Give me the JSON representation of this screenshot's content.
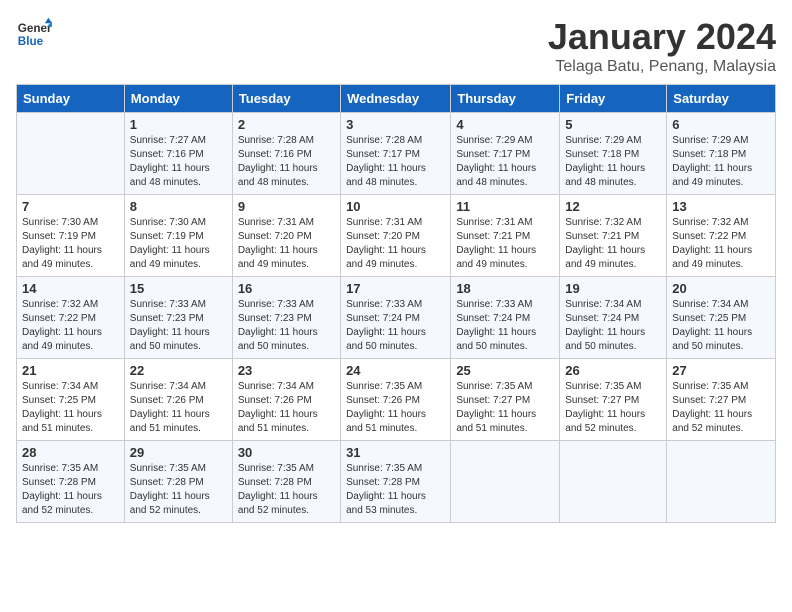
{
  "logo": {
    "line1": "General",
    "line2": "Blue"
  },
  "calendar": {
    "title": "January 2024",
    "subtitle": "Telaga Batu, Penang, Malaysia"
  },
  "days_of_week": [
    "Sunday",
    "Monday",
    "Tuesday",
    "Wednesday",
    "Thursday",
    "Friday",
    "Saturday"
  ],
  "weeks": [
    [
      {
        "day": "",
        "sunrise": "",
        "sunset": "",
        "daylight": ""
      },
      {
        "day": "1",
        "sunrise": "Sunrise: 7:27 AM",
        "sunset": "Sunset: 7:16 PM",
        "daylight": "Daylight: 11 hours and 48 minutes."
      },
      {
        "day": "2",
        "sunrise": "Sunrise: 7:28 AM",
        "sunset": "Sunset: 7:16 PM",
        "daylight": "Daylight: 11 hours and 48 minutes."
      },
      {
        "day": "3",
        "sunrise": "Sunrise: 7:28 AM",
        "sunset": "Sunset: 7:17 PM",
        "daylight": "Daylight: 11 hours and 48 minutes."
      },
      {
        "day": "4",
        "sunrise": "Sunrise: 7:29 AM",
        "sunset": "Sunset: 7:17 PM",
        "daylight": "Daylight: 11 hours and 48 minutes."
      },
      {
        "day": "5",
        "sunrise": "Sunrise: 7:29 AM",
        "sunset": "Sunset: 7:18 PM",
        "daylight": "Daylight: 11 hours and 48 minutes."
      },
      {
        "day": "6",
        "sunrise": "Sunrise: 7:29 AM",
        "sunset": "Sunset: 7:18 PM",
        "daylight": "Daylight: 11 hours and 49 minutes."
      }
    ],
    [
      {
        "day": "7",
        "sunrise": "Sunrise: 7:30 AM",
        "sunset": "Sunset: 7:19 PM",
        "daylight": "Daylight: 11 hours and 49 minutes."
      },
      {
        "day": "8",
        "sunrise": "Sunrise: 7:30 AM",
        "sunset": "Sunset: 7:19 PM",
        "daylight": "Daylight: 11 hours and 49 minutes."
      },
      {
        "day": "9",
        "sunrise": "Sunrise: 7:31 AM",
        "sunset": "Sunset: 7:20 PM",
        "daylight": "Daylight: 11 hours and 49 minutes."
      },
      {
        "day": "10",
        "sunrise": "Sunrise: 7:31 AM",
        "sunset": "Sunset: 7:20 PM",
        "daylight": "Daylight: 11 hours and 49 minutes."
      },
      {
        "day": "11",
        "sunrise": "Sunrise: 7:31 AM",
        "sunset": "Sunset: 7:21 PM",
        "daylight": "Daylight: 11 hours and 49 minutes."
      },
      {
        "day": "12",
        "sunrise": "Sunrise: 7:32 AM",
        "sunset": "Sunset: 7:21 PM",
        "daylight": "Daylight: 11 hours and 49 minutes."
      },
      {
        "day": "13",
        "sunrise": "Sunrise: 7:32 AM",
        "sunset": "Sunset: 7:22 PM",
        "daylight": "Daylight: 11 hours and 49 minutes."
      }
    ],
    [
      {
        "day": "14",
        "sunrise": "Sunrise: 7:32 AM",
        "sunset": "Sunset: 7:22 PM",
        "daylight": "Daylight: 11 hours and 49 minutes."
      },
      {
        "day": "15",
        "sunrise": "Sunrise: 7:33 AM",
        "sunset": "Sunset: 7:23 PM",
        "daylight": "Daylight: 11 hours and 50 minutes."
      },
      {
        "day": "16",
        "sunrise": "Sunrise: 7:33 AM",
        "sunset": "Sunset: 7:23 PM",
        "daylight": "Daylight: 11 hours and 50 minutes."
      },
      {
        "day": "17",
        "sunrise": "Sunrise: 7:33 AM",
        "sunset": "Sunset: 7:24 PM",
        "daylight": "Daylight: 11 hours and 50 minutes."
      },
      {
        "day": "18",
        "sunrise": "Sunrise: 7:33 AM",
        "sunset": "Sunset: 7:24 PM",
        "daylight": "Daylight: 11 hours and 50 minutes."
      },
      {
        "day": "19",
        "sunrise": "Sunrise: 7:34 AM",
        "sunset": "Sunset: 7:24 PM",
        "daylight": "Daylight: 11 hours and 50 minutes."
      },
      {
        "day": "20",
        "sunrise": "Sunrise: 7:34 AM",
        "sunset": "Sunset: 7:25 PM",
        "daylight": "Daylight: 11 hours and 50 minutes."
      }
    ],
    [
      {
        "day": "21",
        "sunrise": "Sunrise: 7:34 AM",
        "sunset": "Sunset: 7:25 PM",
        "daylight": "Daylight: 11 hours and 51 minutes."
      },
      {
        "day": "22",
        "sunrise": "Sunrise: 7:34 AM",
        "sunset": "Sunset: 7:26 PM",
        "daylight": "Daylight: 11 hours and 51 minutes."
      },
      {
        "day": "23",
        "sunrise": "Sunrise: 7:34 AM",
        "sunset": "Sunset: 7:26 PM",
        "daylight": "Daylight: 11 hours and 51 minutes."
      },
      {
        "day": "24",
        "sunrise": "Sunrise: 7:35 AM",
        "sunset": "Sunset: 7:26 PM",
        "daylight": "Daylight: 11 hours and 51 minutes."
      },
      {
        "day": "25",
        "sunrise": "Sunrise: 7:35 AM",
        "sunset": "Sunset: 7:27 PM",
        "daylight": "Daylight: 11 hours and 51 minutes."
      },
      {
        "day": "26",
        "sunrise": "Sunrise: 7:35 AM",
        "sunset": "Sunset: 7:27 PM",
        "daylight": "Daylight: 11 hours and 52 minutes."
      },
      {
        "day": "27",
        "sunrise": "Sunrise: 7:35 AM",
        "sunset": "Sunset: 7:27 PM",
        "daylight": "Daylight: 11 hours and 52 minutes."
      }
    ],
    [
      {
        "day": "28",
        "sunrise": "Sunrise: 7:35 AM",
        "sunset": "Sunset: 7:28 PM",
        "daylight": "Daylight: 11 hours and 52 minutes."
      },
      {
        "day": "29",
        "sunrise": "Sunrise: 7:35 AM",
        "sunset": "Sunset: 7:28 PM",
        "daylight": "Daylight: 11 hours and 52 minutes."
      },
      {
        "day": "30",
        "sunrise": "Sunrise: 7:35 AM",
        "sunset": "Sunset: 7:28 PM",
        "daylight": "Daylight: 11 hours and 52 minutes."
      },
      {
        "day": "31",
        "sunrise": "Sunrise: 7:35 AM",
        "sunset": "Sunset: 7:28 PM",
        "daylight": "Daylight: 11 hours and 53 minutes."
      },
      {
        "day": "",
        "sunrise": "",
        "sunset": "",
        "daylight": ""
      },
      {
        "day": "",
        "sunrise": "",
        "sunset": "",
        "daylight": ""
      },
      {
        "day": "",
        "sunrise": "",
        "sunset": "",
        "daylight": ""
      }
    ]
  ]
}
